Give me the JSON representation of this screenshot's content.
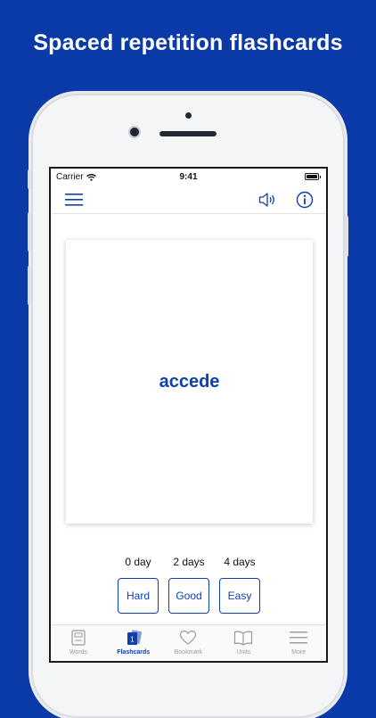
{
  "headline": "Spaced repetition flashcards",
  "status_bar": {
    "carrier": "Carrier",
    "time": "9:41"
  },
  "navbar": {
    "menu_icon": "hamburger-icon",
    "sound_icon": "speaker-icon",
    "info_icon": "info-icon"
  },
  "card": {
    "word": "accede"
  },
  "intervals": [
    "0 day",
    "2 days",
    "4 days"
  ],
  "ratings": [
    "Hard",
    "Good",
    "Easy"
  ],
  "tabs": [
    {
      "label": "Words",
      "icon": "book-icon",
      "active": false
    },
    {
      "label": "Flashcards",
      "icon": "flashcards-icon",
      "badge": "1",
      "active": true
    },
    {
      "label": "Bookmark",
      "icon": "heart-icon",
      "active": false
    },
    {
      "label": "Units",
      "icon": "open-book-icon",
      "active": false
    },
    {
      "label": "More",
      "icon": "menu-lines-icon",
      "active": false
    }
  ],
  "colors": {
    "background": "#0a3aa8",
    "accent": "#0d3fae",
    "tab_inactive": "#9a9a9a"
  }
}
